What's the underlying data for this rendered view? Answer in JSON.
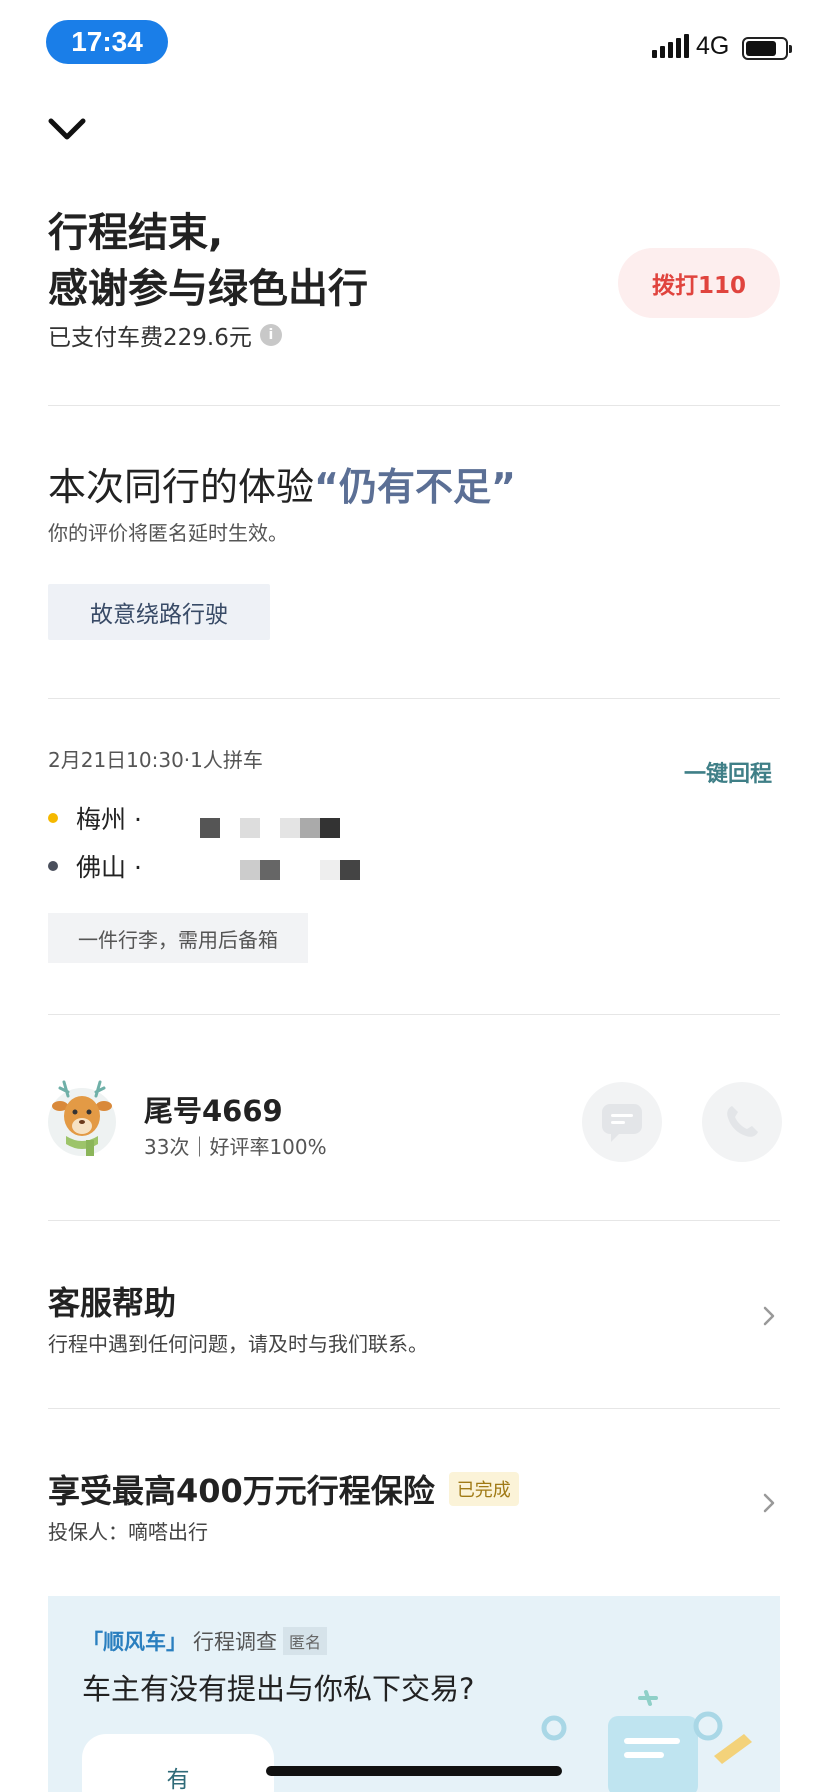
{
  "status_bar": {
    "time": "17:34",
    "network": "4G"
  },
  "trip_end": {
    "title_line1": "行程结束,",
    "title_line2": "感谢参与绿色出行",
    "fare_text": "已支付车费229.6元",
    "call_button": "拨打110"
  },
  "experience": {
    "prefix": "本次同行的体验",
    "rating": "“仍有不足”",
    "subtitle": "你的评价将匿名延时生效。",
    "tag": "故意绕路行驶"
  },
  "trip": {
    "date_info": "2月21日10:30·1人拼车",
    "return_link": "一键回程",
    "origin": "梅州 ·",
    "destination": "佛山 ·",
    "origin_dot_color": "#f5b800",
    "destination_dot_color": "#4a4f5c",
    "luggage_note": "一件行李，需用后备箱"
  },
  "driver": {
    "name": "尾号4669",
    "stats": "33次｜好评率100%"
  },
  "help": {
    "title": "客服帮助",
    "subtitle": "行程中遇到任何问题，请及时与我们联系。"
  },
  "insurance": {
    "title": "享受最高400万元行程保险",
    "badge": "已完成",
    "subtitle": "投保人：嘀嗒出行"
  },
  "survey": {
    "brand": "「顺风车」",
    "label": "行程调查",
    "anon_badge": "匿名",
    "question": "车主有没有提出与你私下交易?",
    "answer_yes": "有"
  }
}
